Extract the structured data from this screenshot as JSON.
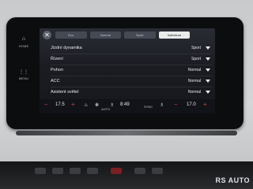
{
  "sidebar": {
    "home_label": "HOME",
    "menu_label": "MENU"
  },
  "tabs": [
    {
      "label": "Eco",
      "active": false
    },
    {
      "label": "Normal",
      "active": false
    },
    {
      "label": "Sport",
      "active": false
    },
    {
      "label": "Individual",
      "active": true
    }
  ],
  "settings": [
    {
      "label": "Jízdní dynamika",
      "value": "Sport"
    },
    {
      "label": "Řízení",
      "value": "Sport"
    },
    {
      "label": "Pohon",
      "value": "Normal"
    },
    {
      "label": "ACC",
      "value": "Normal"
    },
    {
      "label": "Asistent světel",
      "value": "Normal"
    }
  ],
  "climate": {
    "left_temp": "17.5",
    "right_temp": "17.0",
    "minus": "−",
    "plus": "+",
    "time": "8:49",
    "auto_label": "AUTO",
    "sync_label": "SYNC"
  },
  "watermark": "RS AUTO"
}
